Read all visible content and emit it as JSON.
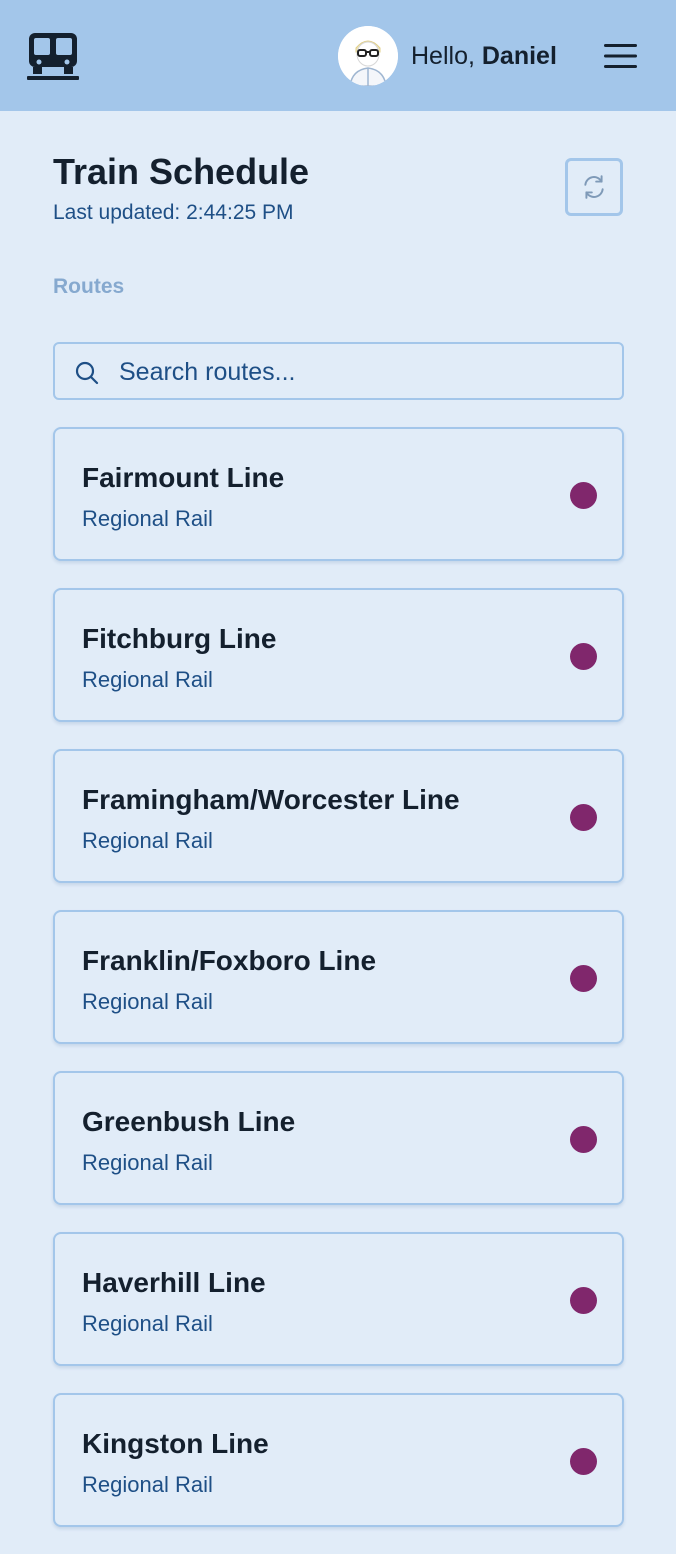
{
  "header": {
    "greeting_prefix": "Hello, ",
    "user_name": "Daniel",
    "logo_icon": "train-icon",
    "menu_icon": "hamburger-menu-icon"
  },
  "page": {
    "title": "Train Schedule",
    "last_updated": "Last updated: 2:44:25 PM",
    "refresh_icon": "refresh-icon"
  },
  "routes_section": {
    "label": "Routes",
    "search_placeholder": "Search routes...",
    "search_icon": "search-icon"
  },
  "routes": [
    {
      "name": "Fairmount Line",
      "type": "Regional Rail",
      "color": "#80276c"
    },
    {
      "name": "Fitchburg Line",
      "type": "Regional Rail",
      "color": "#80276c"
    },
    {
      "name": "Framingham/Worcester Line",
      "type": "Regional Rail",
      "color": "#80276c"
    },
    {
      "name": "Franklin/Foxboro Line",
      "type": "Regional Rail",
      "color": "#80276c"
    },
    {
      "name": "Greenbush Line",
      "type": "Regional Rail",
      "color": "#80276c"
    },
    {
      "name": "Haverhill Line",
      "type": "Regional Rail",
      "color": "#80276c"
    },
    {
      "name": "Kingston Line",
      "type": "Regional Rail",
      "color": "#80276c"
    }
  ],
  "colors": {
    "header_bg": "#a3c6ea",
    "page_bg": "#e1ecf8",
    "text_dark": "#14202e",
    "text_blue": "#1e4f86",
    "label_muted": "#86a9cf",
    "route_dot": "#80276c"
  }
}
